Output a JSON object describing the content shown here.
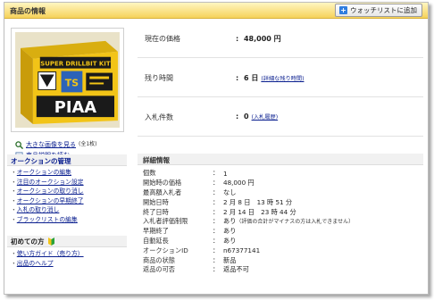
{
  "header": {
    "title": "商品の情報",
    "watch_button": "ウォッチリストに追加"
  },
  "product_image": {
    "box_text": "SUPER DRILLBIT KIT",
    "brand": "PIAA",
    "badge": "TS",
    "colors": {
      "box": "#f2c417",
      "dark": "#1a1a1a"
    }
  },
  "image_links": {
    "large_image": "大きな画像を見る",
    "large_image_count": "(全1枚)",
    "description": "商品説明を読む"
  },
  "summary": [
    {
      "label": "現在の価格",
      "value": "48,000 円",
      "link": ""
    },
    {
      "label": "残り時間",
      "value": "6 日",
      "link": "(詳細な残り時間)"
    },
    {
      "label": "入札件数",
      "value": "0",
      "link": "(入札履歴)"
    }
  ],
  "auction_mgmt": {
    "heading": "オークションの管理",
    "items": [
      "オークションの編集",
      "注目のオークション設定",
      "オークションの取り消し",
      "オークションの早期終了",
      "入札の取り消し",
      "ブラックリストの編集"
    ]
  },
  "beginner": {
    "heading": "初めての方",
    "items": [
      "使い方ガイド（売り方）",
      "出品のヘルプ"
    ]
  },
  "details": {
    "heading": "詳細情報",
    "rows": [
      {
        "key": "個数",
        "sep": "：",
        "value": "1",
        "note": ""
      },
      {
        "key": "開始時の価格",
        "sep": "：",
        "value": "48,000 円",
        "note": ""
      },
      {
        "key": "最高額入札者",
        "sep": "：",
        "value": "なし",
        "note": ""
      },
      {
        "key": "開始日時",
        "sep": "：",
        "value": "2 月 8 日　13 時 51 分",
        "note": ""
      },
      {
        "key": "終了日時",
        "sep": "：",
        "value": "2 月 14 日　23 時 44 分",
        "note": ""
      },
      {
        "key": "入札者評価制限",
        "sep": "：",
        "value": "あり",
        "note": "（評価の合計がマイナスの方は入札できません）"
      },
      {
        "key": "早期終了",
        "sep": "：",
        "value": "あり",
        "note": ""
      },
      {
        "key": "自動延長",
        "sep": "：",
        "value": "あり",
        "note": ""
      },
      {
        "key": "オークションID",
        "sep": "：",
        "value": "n67377141",
        "note": ""
      },
      {
        "key": "商品の状態",
        "sep": "：",
        "value": "新品",
        "note": ""
      },
      {
        "key": "返品の可否",
        "sep": "：",
        "value": "返品不可",
        "note": ""
      }
    ]
  }
}
